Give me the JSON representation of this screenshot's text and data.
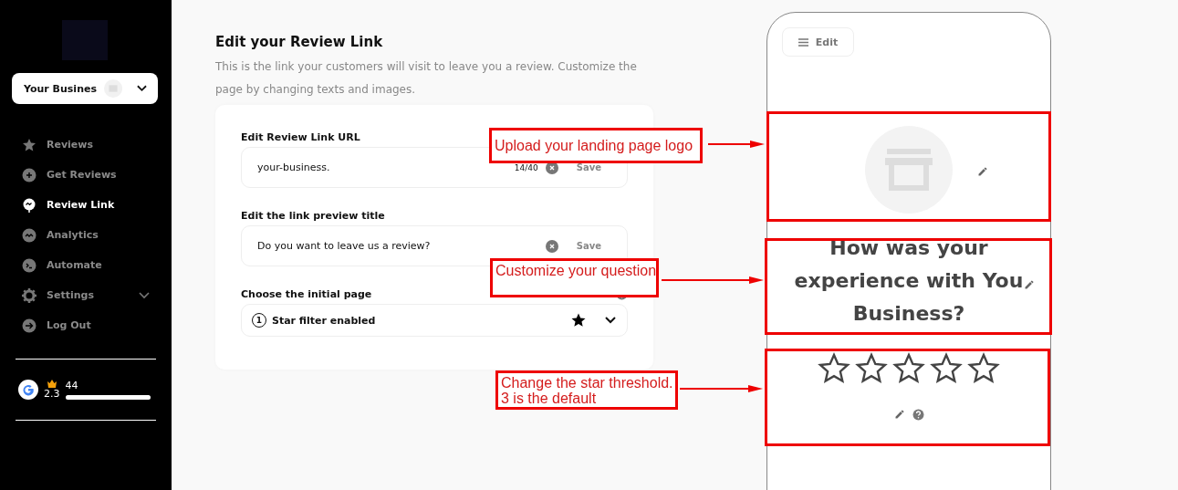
{
  "sidebar": {
    "business_selector": {
      "value": "Your Busines"
    },
    "nav_items": [
      {
        "label": "Reviews",
        "selected": false
      },
      {
        "label": "Get Reviews",
        "selected": false
      },
      {
        "label": "Review Link",
        "selected": true
      },
      {
        "label": "Analytics",
        "selected": false
      },
      {
        "label": "Automate",
        "selected": false
      },
      {
        "label": "Settings",
        "selected": false,
        "expanded": false
      },
      {
        "label": "Log Out",
        "selected": false
      }
    ],
    "rating": {
      "score": "2.3",
      "count": "44",
      "level": 1
    }
  },
  "header": {
    "title": "Edit your Review Link",
    "description": "This is the link your customers will visit to leave you a review. Customize the page by changing texts and images."
  },
  "card": {
    "url_field": {
      "label": "Edit Review Link URL",
      "value": "your-business.",
      "counter": "14/40",
      "save": "Save"
    },
    "title_field": {
      "label": "Edit the link preview title",
      "value": "Do you want to leave us a review?",
      "save": "Save"
    },
    "initial_page": {
      "label": "Choose the initial page",
      "number": "1",
      "value": "Star filter enabled"
    }
  },
  "preview": {
    "edit_button": "Edit",
    "question_lines": [
      "How was your",
      "experience with You",
      "Business?"
    ],
    "stars": 0
  },
  "annotations": [
    {
      "text": "Upload your landing page logo"
    },
    {
      "text": "Customize your question"
    },
    {
      "text": "Change the star threshold.\n3 is the default"
    }
  ]
}
